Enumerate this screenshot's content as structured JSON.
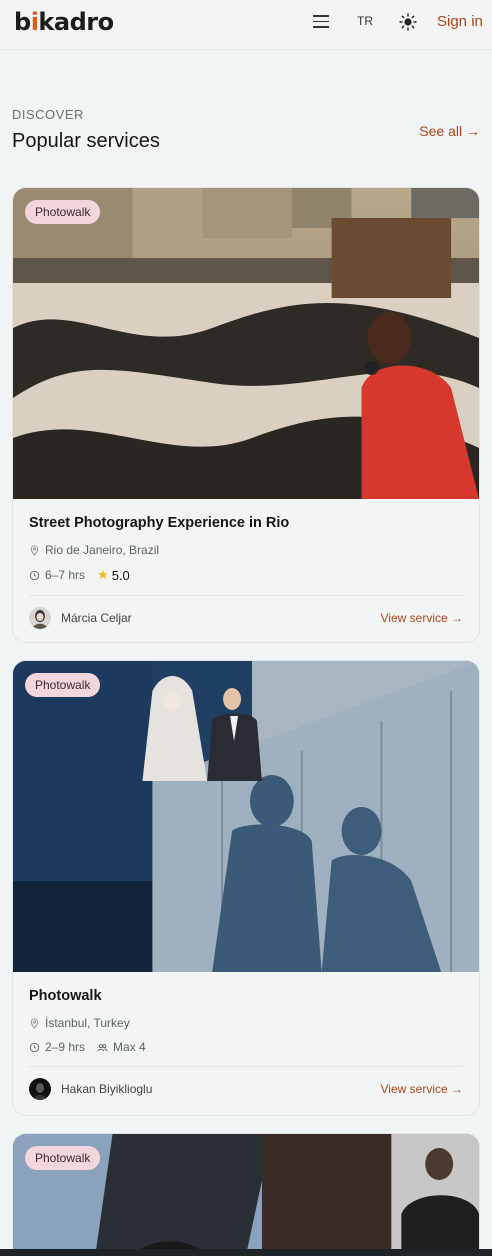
{
  "header": {
    "logo_pre": "b",
    "logo_dot": "i",
    "logo_post": "kadro",
    "menu_icon": "hamburger-icon",
    "language": "TR",
    "theme_icon": "sun-icon",
    "signin_label": "Sign in"
  },
  "section": {
    "eyebrow": "DISCOVER",
    "title": "Popular services",
    "see_all": "See all →"
  },
  "cards": [
    {
      "tag": "Photowalk",
      "title": "Street Photography Experience in Rio",
      "location": "Rio de Janeiro, Brazil",
      "duration": "6–7 hrs",
      "rating": "5.0",
      "host": "Márcia Celjar",
      "link": "View service →"
    },
    {
      "tag": "Photowalk",
      "title": "Photowalk",
      "location": "İstanbul, Turkey",
      "duration": "2–9 hrs",
      "group": "Max 4",
      "host": "Hakan Biyiklioglu",
      "link": "View service →"
    },
    {
      "tag": "Photowalk"
    }
  ],
  "colors": {
    "accent": "#a9461c",
    "tag_bg": "#f3d6dc",
    "star": "#f1b81b"
  }
}
